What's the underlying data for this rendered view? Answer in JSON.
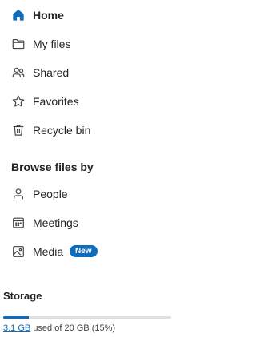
{
  "nav": {
    "items": [
      {
        "label": "Home",
        "icon": "home-icon",
        "active": true
      },
      {
        "label": "My files",
        "icon": "folder-icon"
      },
      {
        "label": "Shared",
        "icon": "people-icon"
      },
      {
        "label": "Favorites",
        "icon": "star-icon"
      },
      {
        "label": "Recycle bin",
        "icon": "trash-icon"
      }
    ]
  },
  "browse": {
    "heading": "Browse files by",
    "items": [
      {
        "label": "People",
        "icon": "person-icon"
      },
      {
        "label": "Meetings",
        "icon": "calendar-icon"
      },
      {
        "label": "Media",
        "icon": "image-icon",
        "badge": "New"
      }
    ]
  },
  "storage": {
    "heading": "Storage",
    "used": "3.1 GB",
    "suffix": "used of 20 GB (15%)",
    "percent": 15
  },
  "colors": {
    "accent": "#0f6cbd",
    "text": "#242424",
    "track": "#e0e0e0"
  }
}
